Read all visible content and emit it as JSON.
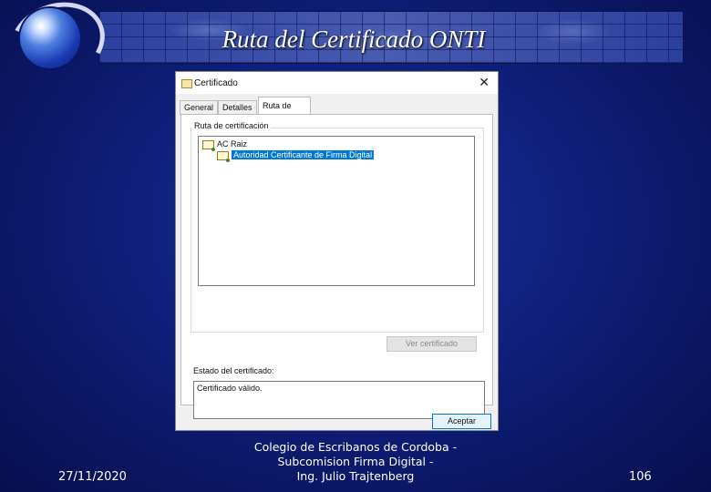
{
  "slide": {
    "title": "Ruta del Certificado ONTI",
    "footer": {
      "date": "27/11/2020",
      "center_line1": "Colegio de Escribanos de Cordoba -",
      "center_line2": "Subcomision Firma Digital -",
      "center_line3": "Ing. Julio Trajtenberg",
      "page": "106"
    }
  },
  "dialog": {
    "title": "Certificado",
    "close_icon": "close-icon",
    "tabs": [
      "General",
      "Detalles",
      "Ruta de certificación"
    ],
    "active_tab": "Ruta de certificación",
    "path_group_label": "Ruta de certificación",
    "tree": [
      {
        "label": "AC Raiz",
        "level": 0,
        "selected": false
      },
      {
        "label": "Autoridad Certificante de Firma Digital",
        "level": 1,
        "selected": true
      }
    ],
    "view_cert_button": "Ver certificado",
    "status_label": "Estado del certificado:",
    "status_text": "Certificado válido.",
    "ok_button": "Aceptar"
  }
}
